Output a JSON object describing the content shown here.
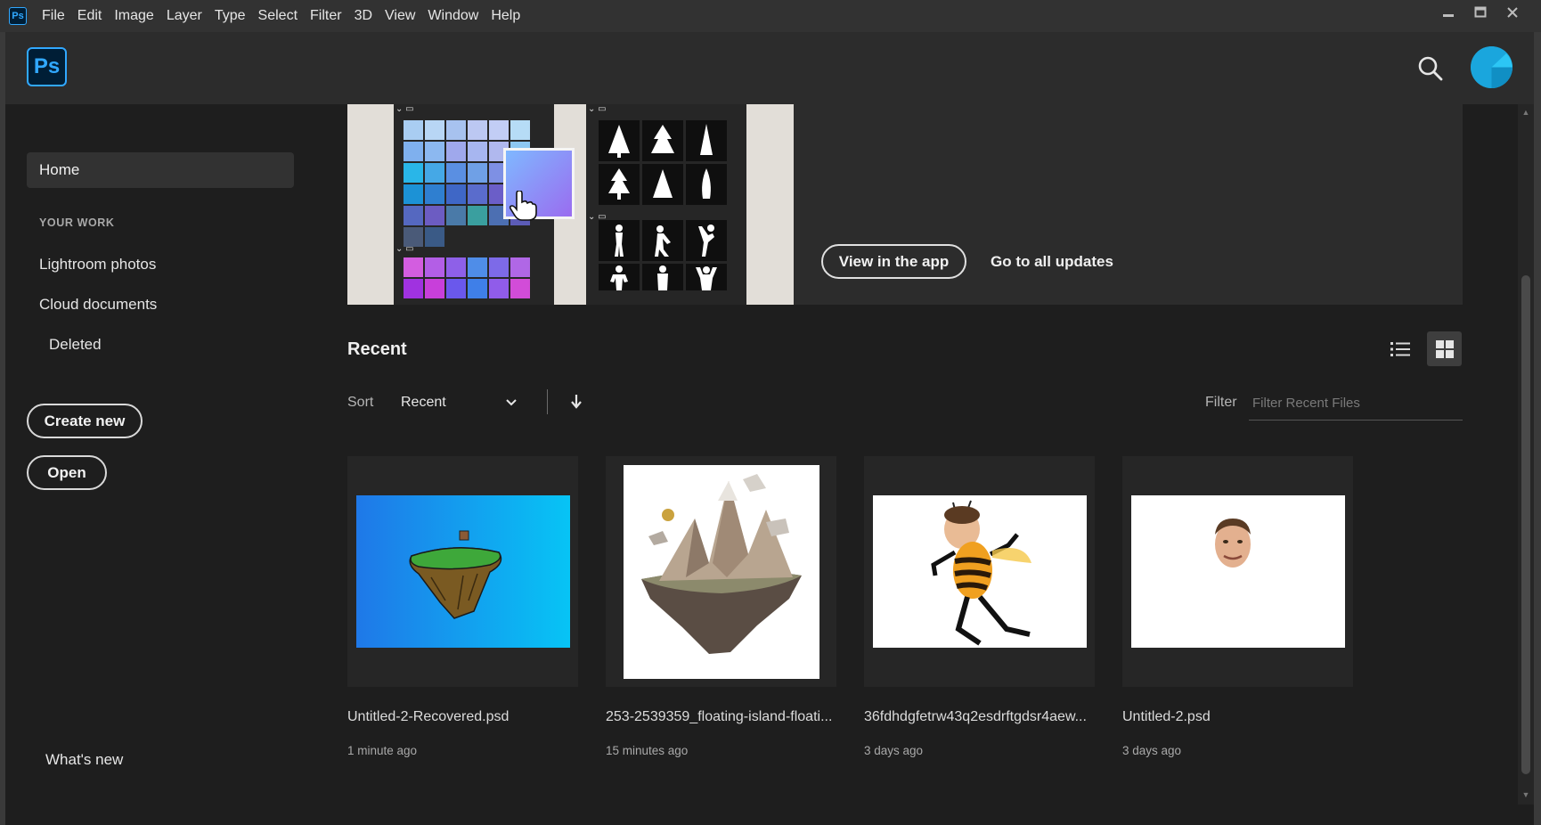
{
  "app": {
    "mini_logo": "Ps",
    "logo": "Ps"
  },
  "menu": [
    "File",
    "Edit",
    "Image",
    "Layer",
    "Type",
    "Select",
    "Filter",
    "3D",
    "View",
    "Window",
    "Help"
  ],
  "window_controls": [
    "minimize-icon",
    "maximize-icon",
    "close-icon"
  ],
  "header": {
    "icons": [
      "search-icon",
      "avatar"
    ]
  },
  "sidebar": {
    "home": "Home",
    "section_label": "YOUR WORK",
    "lightroom": "Lightroom photos",
    "cloud_docs": "Cloud documents",
    "deleted": "Deleted",
    "create_new": "Create new",
    "open": "Open",
    "whats_new": "What's new"
  },
  "banner": {
    "view_in_app": "View in the app",
    "go_to_updates": "Go to all updates"
  },
  "recent": {
    "title": "Recent",
    "sort_label": "Sort",
    "sort_value": "Recent",
    "filter_label": "Filter",
    "filter_placeholder": "Filter Recent Files",
    "view_modes": [
      "list-view-icon",
      "grid-view-icon"
    ],
    "active_view": "grid"
  },
  "files": [
    {
      "name": "Untitled-2-Recovered.psd",
      "time": "1 minute ago"
    },
    {
      "name": "253-2539359_floating-island-floati...",
      "time": "15 minutes ago"
    },
    {
      "name": "36fdhdgfetrw43q2esdrftgdsr4aew...",
      "time": "3 days ago"
    },
    {
      "name": "Untitled-2.psd",
      "time": "3 days ago"
    }
  ],
  "colors": {
    "accent": "#31a8ff",
    "background": "#1e1e1e",
    "panel": "#2c2c2c",
    "avatar": "#22b2e8"
  }
}
